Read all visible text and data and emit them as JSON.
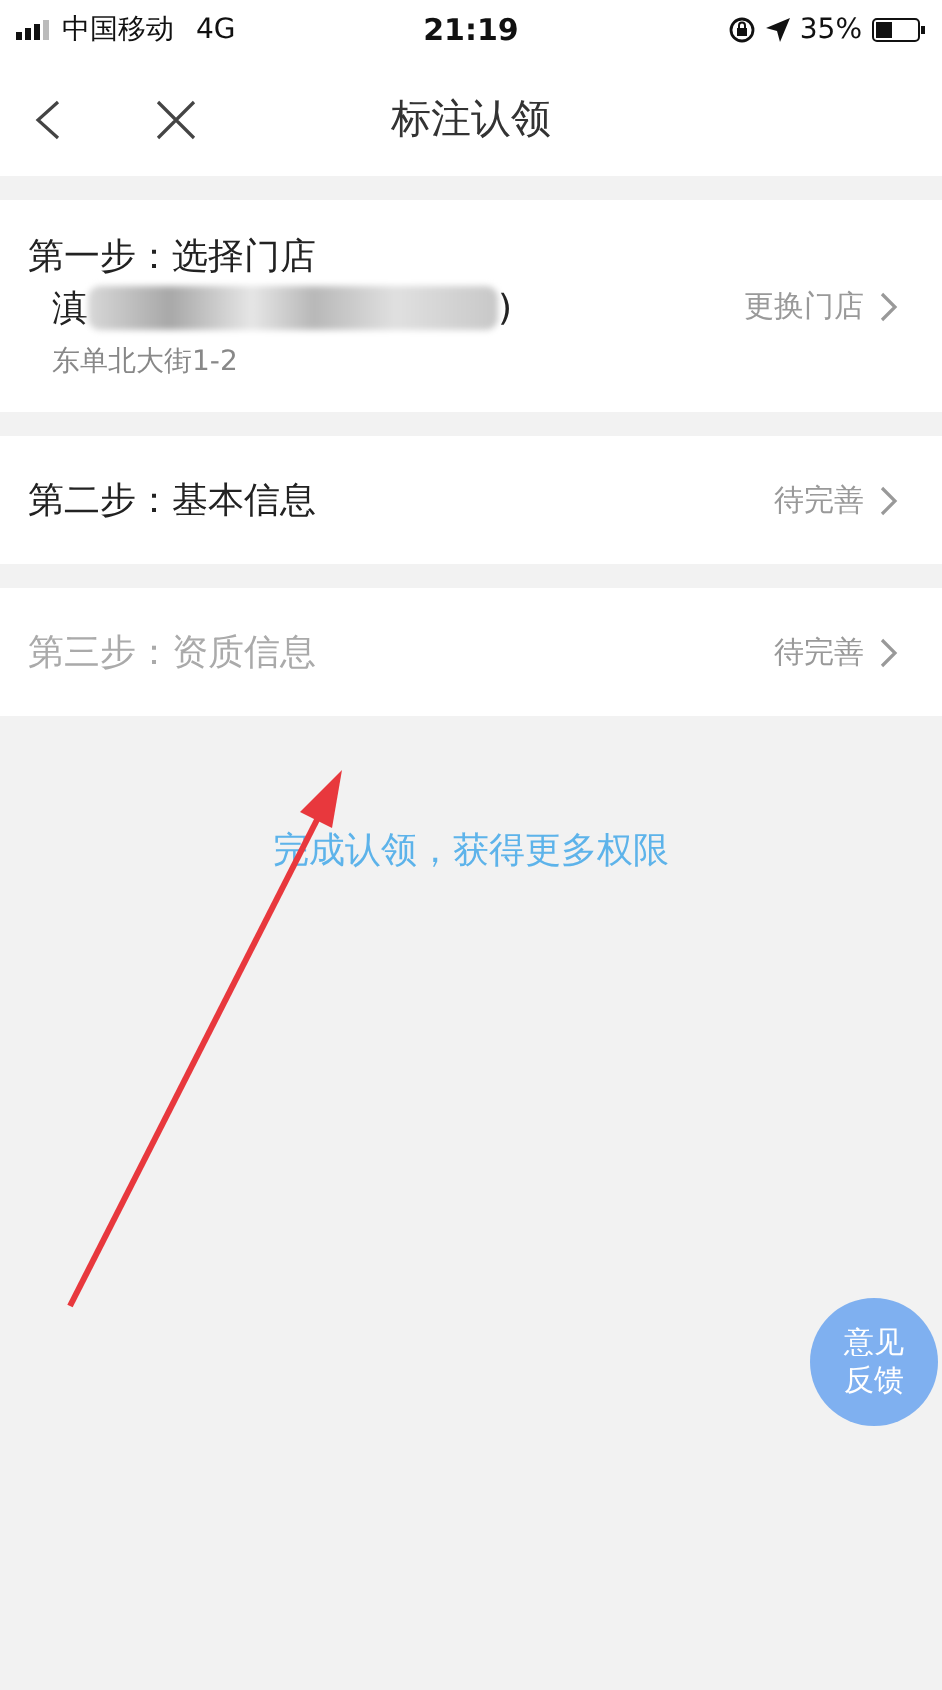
{
  "status_bar": {
    "carrier": "中国移动",
    "network": "4G",
    "time": "21:19",
    "battery": "35%"
  },
  "nav": {
    "title": "标注认领"
  },
  "steps": [
    {
      "kind": "store",
      "title": "第一步：选择门店",
      "name_start": "滇",
      "name_end": ")",
      "address": "东单北大街1-2",
      "action": "更换门店",
      "disabled": false
    },
    {
      "kind": "status",
      "title": "第二步：基本信息",
      "status": "待完善",
      "disabled": false
    },
    {
      "kind": "status",
      "title": "第三步：资质信息",
      "status": "待完善",
      "disabled": true
    }
  ],
  "hint": "完成认领，获得更多权限",
  "feedback_button": {
    "label": "意见反馈"
  }
}
